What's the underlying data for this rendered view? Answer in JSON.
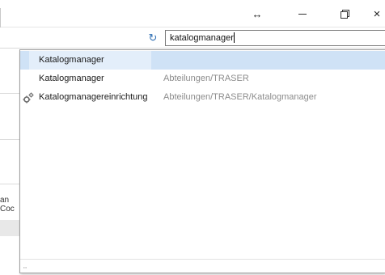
{
  "window": {
    "resize_glyph": "↔",
    "close_glyph": "×"
  },
  "toolbar": {
    "refresh_glyph": "↻",
    "search_value": "katalogmanager"
  },
  "background": {
    "fragment_line1": "an",
    "fragment_line2": "Coc"
  },
  "dropdown": {
    "items": [
      {
        "name": "Katalogmanager",
        "path": "",
        "selected": true,
        "icon": null
      },
      {
        "name": "Katalogmanager",
        "path": "Abteilungen/TRASER",
        "selected": false,
        "icon": null
      },
      {
        "name": "Katalogmanagereinrichtung",
        "path": "Abteilungen/TRASER/Katalogmanager",
        "selected": false,
        "icon": "gears-icon"
      }
    ],
    "grip_glyph": "⠤"
  },
  "colors": {
    "selection": "#cfe2f6",
    "refresh_icon": "#2f6fb3",
    "path_text": "#8c8c8c"
  }
}
